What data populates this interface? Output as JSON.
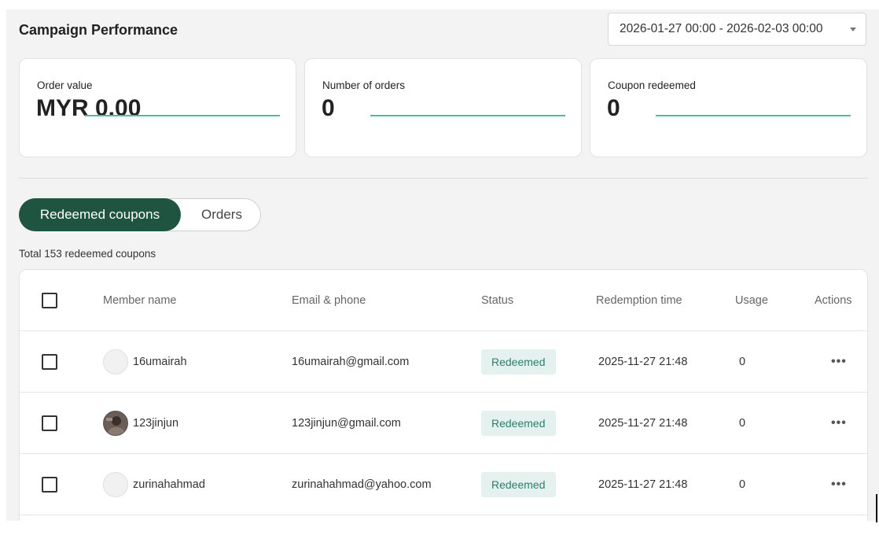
{
  "header": {
    "title": "Campaign Performance",
    "date_range": "2026-01-27 00:00 - 2026-02-03 00:00"
  },
  "metrics": [
    {
      "label": "Order value",
      "value": "MYR 0.00"
    },
    {
      "label": "Number of orders",
      "value": "0"
    },
    {
      "label": "Coupon redeemed",
      "value": "0"
    }
  ],
  "tabs": {
    "active": "Redeemed coupons",
    "inactive": "Orders"
  },
  "total_text": "Total 153 redeemed coupons",
  "table": {
    "columns": [
      "Member name",
      "Email & phone",
      "Status",
      "Redemption time",
      "Usage",
      "Actions"
    ],
    "rows": [
      {
        "name": "16umairah",
        "email": "16umairah@gmail.com",
        "status": "Redeemed",
        "time": "2025-11-27 21:48",
        "usage": "0",
        "actions": "•••",
        "avatar": "placeholder"
      },
      {
        "name": "123jinjun",
        "email": "123jinjun@gmail.com",
        "status": "Redeemed",
        "time": "2025-11-27 21:48",
        "usage": "0",
        "actions": "•••",
        "avatar": "photo"
      },
      {
        "name": "zurinahahmad",
        "email": "zurinahahmad@yahoo.com",
        "status": "Redeemed",
        "time": "2025-11-27 21:48",
        "usage": "0",
        "actions": "•••",
        "avatar": "placeholder"
      }
    ]
  },
  "colors": {
    "accent": "#1f5540",
    "sparkline": "#4dbd94",
    "badge_bg": "#e4f1ee",
    "badge_text": "#2e7d6a"
  }
}
